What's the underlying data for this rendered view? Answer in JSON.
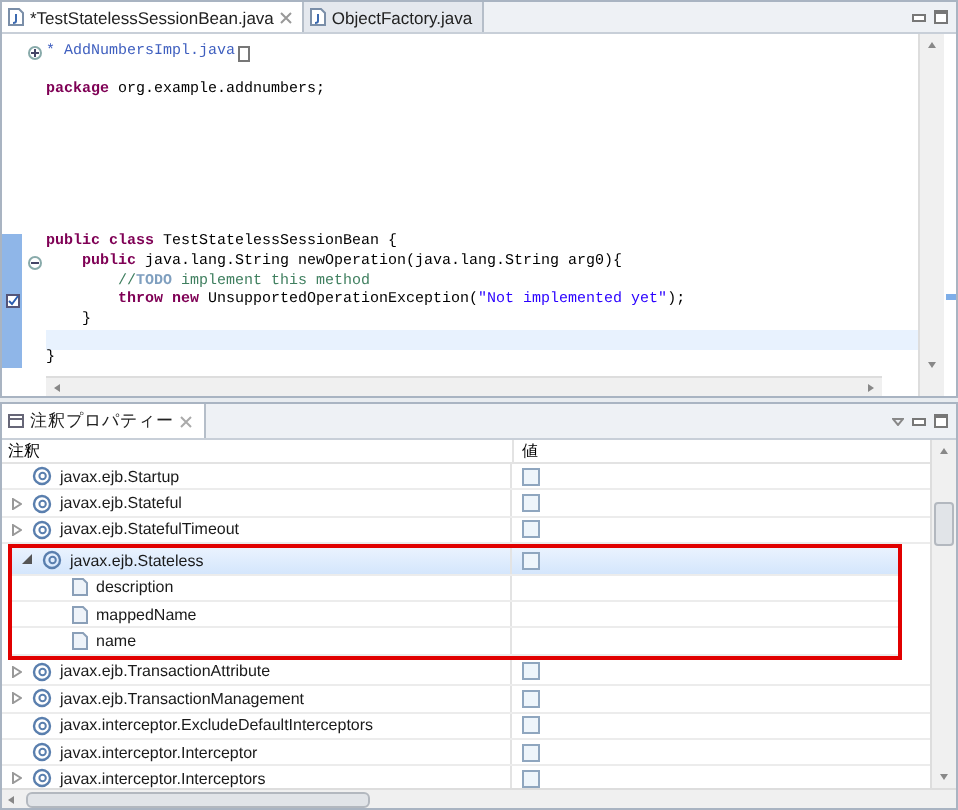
{
  "editor": {
    "tabs": [
      {
        "label": "*TestStatelessSessionBean.java",
        "selected": true,
        "closable": true
      },
      {
        "label": "ObjectFactory.java",
        "selected": false,
        "closable": false
      }
    ],
    "lines": [
      {
        "folded": true,
        "segments": [
          {
            "kind": "doc",
            "text": "* AddNumbersImpl.java"
          }
        ]
      },
      {
        "kind": "blank"
      },
      {
        "segments": [
          {
            "kind": "keyword",
            "text": "package"
          },
          {
            "kind": "plain",
            "text": " org.example.addnumbers;"
          }
        ]
      },
      {
        "kind": "blank"
      },
      {
        "kind": "blank"
      },
      {
        "kind": "blank"
      },
      {
        "kind": "blank"
      },
      {
        "kind": "blank"
      },
      {
        "kind": "blank"
      },
      {
        "kind": "blank"
      },
      {
        "segments": [
          {
            "kind": "keyword",
            "text": "public class"
          },
          {
            "kind": "plain",
            "text": " TestStatelessSessionBean {"
          }
        ]
      },
      {
        "foldable": true,
        "segments": [
          {
            "kind": "keyword",
            "text": "    public"
          },
          {
            "kind": "plain",
            "text": " java.lang.String newOperation(java.lang.String arg0){"
          }
        ]
      },
      {
        "segments": [
          {
            "kind": "comment",
            "text": "        //"
          },
          {
            "kind": "todo",
            "text": "TODO"
          },
          {
            "kind": "comment",
            "text": " implement this method"
          }
        ]
      },
      {
        "task_marker": true,
        "segments": [
          {
            "kind": "keyword",
            "text": "        throw new"
          },
          {
            "kind": "plain",
            "text": " UnsupportedOperationException("
          },
          {
            "kind": "string",
            "text": "\"Not implemented yet\""
          },
          {
            "kind": "plain",
            "text": ");"
          }
        ]
      },
      {
        "segments": [
          {
            "kind": "plain",
            "text": "    }"
          }
        ]
      },
      {
        "kind": "blank",
        "current": true
      },
      {
        "segments": [
          {
            "kind": "plain",
            "text": "}"
          }
        ]
      }
    ]
  },
  "annotations_panel": {
    "tab": {
      "label": "注釈プロパティー"
    },
    "columns": [
      "注釈",
      "値"
    ],
    "rows": [
      {
        "kind": "annotation",
        "name": "javax.ejb.Startup",
        "expandable": false,
        "expanded": false,
        "selected": false,
        "framed": false,
        "checked": false
      },
      {
        "kind": "annotation",
        "name": "javax.ejb.Stateful",
        "expandable": true,
        "expanded": false,
        "selected": false,
        "framed": false,
        "checked": false
      },
      {
        "kind": "annotation",
        "name": "javax.ejb.StatefulTimeout",
        "expandable": true,
        "expanded": false,
        "selected": false,
        "framed": false,
        "checked": false
      },
      {
        "kind": "annotation",
        "name": "javax.ejb.Stateless",
        "expandable": true,
        "expanded": true,
        "selected": true,
        "framed": true,
        "checked": false,
        "children": [
          {
            "kind": "attribute",
            "name": "description",
            "selected": false
          },
          {
            "kind": "attribute",
            "name": "mappedName",
            "selected": false
          },
          {
            "kind": "attribute",
            "name": "name",
            "selected": false
          }
        ]
      },
      {
        "kind": "annotation",
        "name": "javax.ejb.TransactionAttribute",
        "expandable": true,
        "expanded": false,
        "selected": false,
        "framed": false,
        "checked": false
      },
      {
        "kind": "annotation",
        "name": "javax.ejb.TransactionManagement",
        "expandable": true,
        "expanded": false,
        "selected": false,
        "framed": false,
        "checked": false
      },
      {
        "kind": "annotation",
        "name": "javax.interceptor.ExcludeDefaultInterceptors",
        "expandable": false,
        "expanded": false,
        "selected": false,
        "framed": false,
        "checked": false
      },
      {
        "kind": "annotation",
        "name": "javax.interceptor.Interceptor",
        "expandable": false,
        "expanded": false,
        "selected": false,
        "framed": false,
        "checked": false
      },
      {
        "kind": "annotation",
        "name": "javax.interceptor.Interceptors",
        "expandable": true,
        "expanded": false,
        "selected": false,
        "framed": false,
        "checked": false
      }
    ]
  }
}
